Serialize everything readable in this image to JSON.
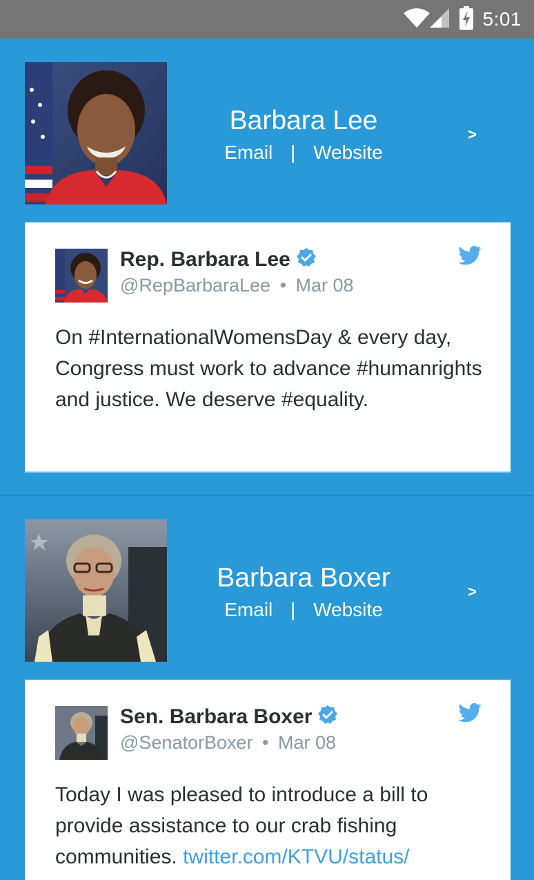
{
  "status_bar": {
    "time": "5:01",
    "icons": [
      "wifi-icon",
      "cell-signal-icon",
      "battery-charging-icon"
    ]
  },
  "reps": [
    {
      "name": "Barbara Lee",
      "email_label": "Email",
      "separator": "|",
      "website_label": "Website",
      "chevron": ">",
      "tweet": {
        "author_name": "Rep. Barbara Lee",
        "handle": "@RepBarbaraLee",
        "dot": "•",
        "date": "Mar 08",
        "text": "On #InternationalWomensDay & every day, Congress must work to advance #humanrights and justice. We deserve #equality.",
        "link": ""
      }
    },
    {
      "name": "Barbara Boxer",
      "email_label": "Email",
      "separator": "|",
      "website_label": "Website",
      "chevron": ">",
      "tweet": {
        "author_name": "Sen. Barbara Boxer",
        "handle": "@SenatorBoxer",
        "dot": "•",
        "date": "Mar 08",
        "text": "Today I was pleased to introduce a bill to provide assistance to our crab fishing communities. ",
        "link": "twitter.com/KTVU/status/"
      }
    }
  ],
  "colors": {
    "background": "#2a99d8",
    "status_bar": "#757575",
    "twitter_blue": "#55acee",
    "verified_blue": "#4aa8e8",
    "link": "#3ba1e4"
  }
}
